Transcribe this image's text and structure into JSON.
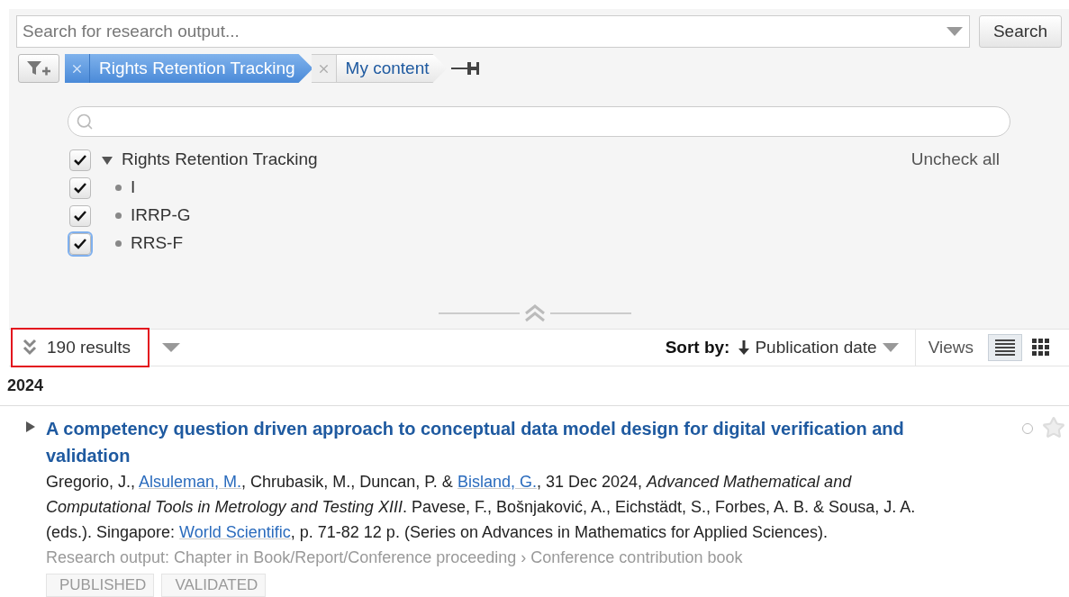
{
  "search": {
    "placeholder": "Search for research output...",
    "button": "Search"
  },
  "filters": [
    {
      "label": "Rights Retention Tracking",
      "selected": true
    },
    {
      "label": "My content",
      "selected": false
    }
  ],
  "filter_panel": {
    "uncheck_all": "Uncheck all",
    "tree": {
      "label": "Rights Retention Tracking",
      "checked": true,
      "expanded": true,
      "focused": false,
      "children": [
        {
          "label": "I",
          "checked": true,
          "focused": false
        },
        {
          "label": "IRRP-G",
          "checked": true,
          "focused": false
        },
        {
          "label": "RRS-F",
          "checked": true,
          "focused": true
        }
      ]
    }
  },
  "results": {
    "count": "190 results",
    "highlighted": true,
    "sort_label": "Sort by:",
    "sort_value": "Publication date",
    "views_label": "Views",
    "views": [
      {
        "kind": "list",
        "selected": true
      },
      {
        "kind": "grid",
        "selected": false
      }
    ]
  },
  "groups": [
    {
      "year": "2024",
      "items": [
        {
          "title": "A competency question driven approach to conceptual data model design for digital verification and validation",
          "expanded": false,
          "citation": [
            {
              "kind": "text",
              "text": "Gregorio, J., "
            },
            {
              "kind": "link",
              "text": "Alsuleman, M."
            },
            {
              "kind": "text",
              "text": ", Chrubasik, M., Duncan, P. & "
            },
            {
              "kind": "link",
              "text": "Bisland, G."
            },
            {
              "kind": "text",
              "text": ", 31 Dec 2024, "
            },
            {
              "kind": "italic",
              "text": "Advanced Mathematical and Computational Tools in Metrology and Testing XIII"
            },
            {
              "kind": "text",
              "text": ". Pavese, F., Bošnjaković, A., Eichstädt, S., Forbes, A. B. & Sousa, J. A. (eds.). Singapore: "
            },
            {
              "kind": "link",
              "text": "World Scientific"
            },
            {
              "kind": "text",
              "text": ", p. 71-82 12 p. (Series on Advances in Mathematics for Applied Sciences)."
            }
          ],
          "type_line": "Research output: Chapter in Book/Report/Conference proceeding › Conference contribution book",
          "tags": [
            "PUBLISHED",
            "VALIDATED"
          ]
        }
      ]
    }
  ]
}
